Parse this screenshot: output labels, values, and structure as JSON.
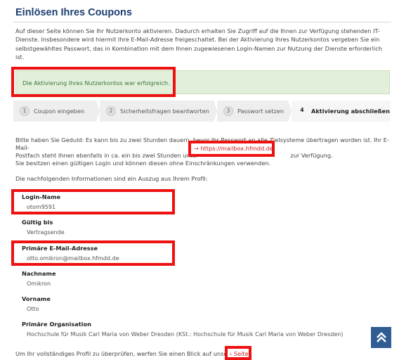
{
  "page": {
    "title": "Einlösen Ihres Coupons",
    "intro": "Auf dieser Seite können Sie Ihr Nutzerkonto aktivieren. Dadurch erhalten Sie Zugriff auf die Ihnen zur Verfügung stehenden IT-Dienste. Insbesondere wird hiermit Ihre E-Mail-Adresse freigeschaltet. Bei der Aktivierung Ihres Nutzerkontos vergeben Sie ein selbstgewähltes Passwort, das in Kombination mit dem Ihnen zugewiesenen Login-Namen zur Nutzung der Dienste erforderlich ist."
  },
  "alert": {
    "text": "Die Aktivierung Ihres Nutzerkontos war erfolgreich."
  },
  "steps": [
    {
      "num": "1",
      "label": "Coupon eingeben"
    },
    {
      "num": "2",
      "label": "Sicherheitsfragen beantworten"
    },
    {
      "num": "3",
      "label": "Passwort setzen"
    },
    {
      "num": "4",
      "label": "Aktivierung abschließen"
    }
  ],
  "wait": {
    "line1": "Bitte haben Sie Geduld: Es kann bis zu zwei Stunden dauern, bevor Ihr Passwort an alle Zielsysteme übertragen worden ist. Ihr E-Mail-",
    "line2_pre": "Postfach steht Ihnen ebenfalls in ca. ein bis zwei Stunden unter",
    "line2_post": "zur Verfügung.",
    "line3": "Sie besitzen einen gültigen Login und können diesen ohne Einschränkungen verwenden.",
    "mail_link": "⇢ https://mailbox.hfmdd.de"
  },
  "profile": {
    "intro": "Die nachfolgenden Informationen sind ein Auszug aus Ihrem Profil:",
    "fields": [
      {
        "label": "Login-Name",
        "value": "otom9591"
      },
      {
        "label": "Gültig bis",
        "value": "Vertragsende"
      },
      {
        "label": "Primäre E-Mail-Adresse",
        "value": "otto.omikron@mailbox.hfmdd.de"
      },
      {
        "label": "Nachname",
        "value": "Omikron"
      },
      {
        "label": "Vorname",
        "value": "Otto"
      },
      {
        "label": "Primäre Organisation",
        "value": "Hochschule für Musik Carl Maria von Weber Dresden (KSt.: Hochschule für Musik Carl Maria von Weber Dresden)"
      }
    ]
  },
  "footer": {
    "text": "Um Ihr vollständiges Profil zu überprüfen, werfen Sie einen Blick auf unsere",
    "link": "› Seite"
  },
  "icons": {
    "scroll_top": "double-chevron-up-icon"
  },
  "colors": {
    "title": "#1d3f70",
    "alert_bg": "#e2efda",
    "highlight": "#e11111",
    "scroll_btn": "#2f5d93"
  }
}
